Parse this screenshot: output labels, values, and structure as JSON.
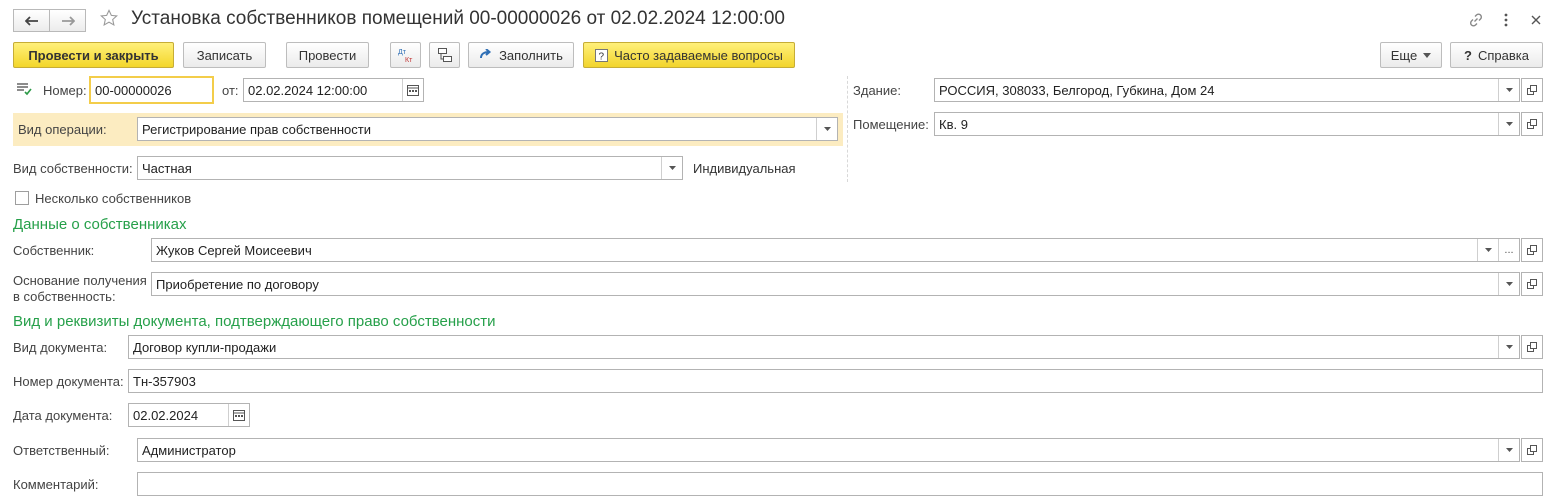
{
  "window": {
    "title": "Установка собственников помещений 00-00000026 от 02.02.2024 12:00:00"
  },
  "toolbar": {
    "post_close_label": "Провести и закрыть",
    "save_label": "Записать",
    "post_label": "Провести",
    "dtkt_label": "Дт Кт",
    "fill_label": "Заполнить",
    "faq_label": "Часто задаваемые вопросы",
    "more_label": "Еще",
    "help_label": "Справка"
  },
  "header": {
    "number_label": "Номер:",
    "number_value": "00-00000026",
    "date_label": "от:",
    "date_value": "02.02.2024 12:00:00",
    "operation_label": "Вид операции:",
    "operation_value": "Регистрирование прав собственности",
    "ownership_label": "Вид собственности:",
    "ownership_value": "Частная",
    "ownership_note": "Индивидуальная",
    "multiple_owners_label": "Несколько собственников",
    "building_label": "Здание:",
    "building_value": "РОССИЯ, 308033, Белгород, Губкина, Дом 24",
    "premises_label": "Помещение:",
    "premises_value": "Кв. 9"
  },
  "owners_section": {
    "title": "Данные о собственниках",
    "owner_label": "Собственник:",
    "owner_value": "Жуков Сергей Моисеевич",
    "basis_label_line1": "Основание получения",
    "basis_label_line2": "в собственность:",
    "basis_value": "Приобретение по договору"
  },
  "document_section": {
    "title": "Вид и реквизиты документа, подтверждающего право собственности",
    "doc_type_label": "Вид документа:",
    "doc_type_value": "Договор купли-продажи",
    "doc_number_label": "Номер документа:",
    "doc_number_value": "Тн-357903",
    "doc_date_label": "Дата документа:",
    "doc_date_value": "02.02.2024"
  },
  "footer": {
    "responsible_label": "Ответственный:",
    "responsible_value": "Администратор",
    "comment_label": "Комментарий:",
    "comment_value": ""
  },
  "icons": {
    "back": "arrow-left-icon",
    "forward": "arrow-right-icon",
    "favorite": "star-icon",
    "link": "link-icon",
    "menu": "more-vertical-icon",
    "close": "close-icon"
  },
  "colors": {
    "accent_yellow": "#f3d62a",
    "section_green": "#26a04a",
    "highlight_row": "#fcecc1"
  }
}
